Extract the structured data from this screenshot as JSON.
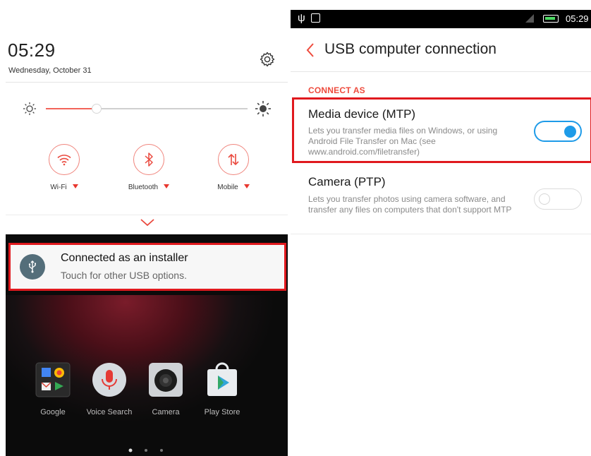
{
  "left_screen": {
    "time": "05:29",
    "date": "Wednesday, October 31",
    "settings_icon": "gear-icon",
    "brightness_level_fraction": 0.25,
    "tiles": [
      {
        "label": "Wi-Fi",
        "icon": "wifi-icon"
      },
      {
        "label": "Bluetooth",
        "icon": "bluetooth-icon"
      },
      {
        "label": "Mobile",
        "icon": "mobile-data-icon"
      }
    ],
    "notification": {
      "title": "Connected as an installer",
      "subtitle": "Touch for other USB options.",
      "icon": "usb-icon"
    },
    "apps": [
      {
        "label": "Google",
        "icon": "google-folder-icon"
      },
      {
        "label": "Voice Search",
        "icon": "microphone-icon"
      },
      {
        "label": "Camera",
        "icon": "camera-icon"
      },
      {
        "label": "Play Store",
        "icon": "play-store-icon"
      }
    ]
  },
  "right_screen": {
    "status_bar": {
      "time": "05:29",
      "icons": [
        "usb-icon",
        "screenshot-icon",
        "signal-icon",
        "battery-icon"
      ]
    },
    "header": {
      "back_icon": "chevron-left-icon",
      "title": "USB computer connection"
    },
    "section_label": "CONNECT AS",
    "options": [
      {
        "title": "Media device (MTP)",
        "description": "Lets you transfer media files on Windows, or using Android File Transfer on Mac (see www.android.com/filetransfer)",
        "enabled": true
      },
      {
        "title": "Camera (PTP)",
        "description": "Lets you transfer photos using camera software, and transfer any files on computers that don't support MTP",
        "enabled": false
      }
    ]
  },
  "colors": {
    "accent": "#ee4b3d",
    "toggle_on": "#1e9be8",
    "highlight_border": "#e0191e",
    "usb_badge": "#546e7a"
  }
}
